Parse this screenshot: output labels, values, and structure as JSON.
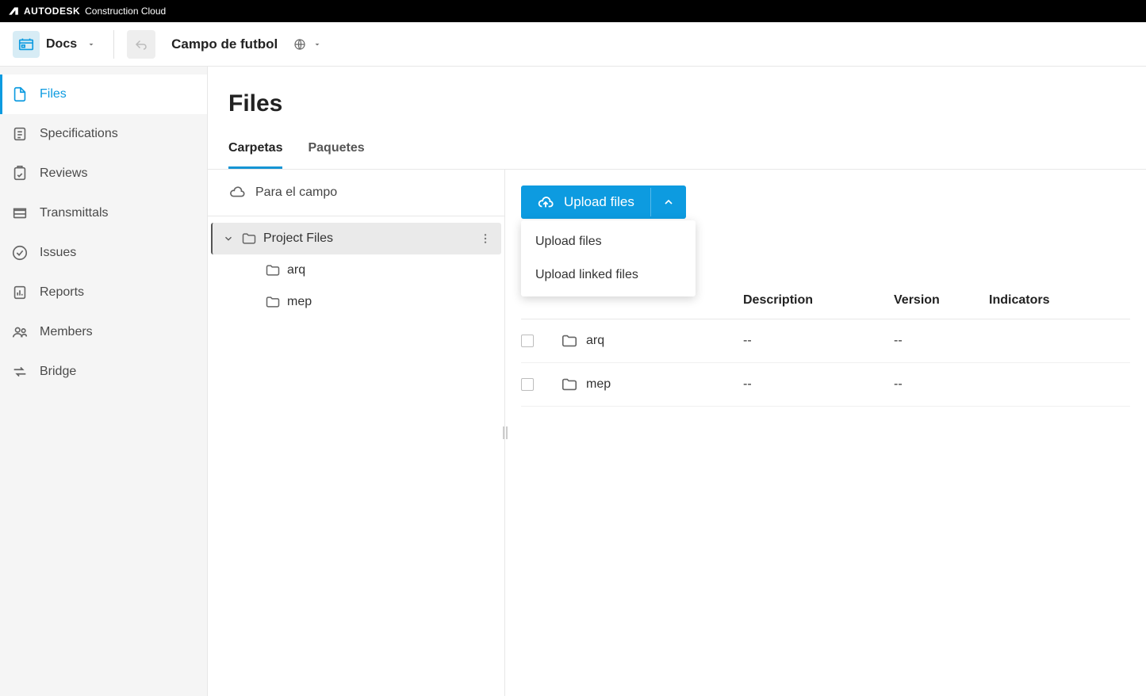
{
  "brand": {
    "name": "AUTODESK",
    "suffix": "Construction Cloud"
  },
  "toolbar": {
    "module": "Docs",
    "project": "Campo de futbol"
  },
  "sidebar": {
    "items": [
      {
        "label": "Files",
        "active": true
      },
      {
        "label": "Specifications"
      },
      {
        "label": "Reviews"
      },
      {
        "label": "Transmittals"
      },
      {
        "label": "Issues"
      },
      {
        "label": "Reports"
      },
      {
        "label": "Members"
      },
      {
        "label": "Bridge"
      }
    ]
  },
  "page": {
    "title": "Files"
  },
  "tabs": [
    {
      "label": "Carpetas",
      "active": true
    },
    {
      "label": "Paquetes"
    }
  ],
  "tree": {
    "topItem": "Para el campo",
    "root": "Project Files",
    "children": [
      "arq",
      "mep"
    ]
  },
  "uploadButton": {
    "label": "Upload files"
  },
  "uploadMenu": [
    "Upload files",
    "Upload linked files"
  ],
  "table": {
    "headers": {
      "description": "Description",
      "version": "Version",
      "indicators": "Indicators"
    },
    "rows": [
      {
        "name": "arq",
        "description": "--",
        "version": "--"
      },
      {
        "name": "mep",
        "description": "--",
        "version": "--"
      }
    ]
  }
}
